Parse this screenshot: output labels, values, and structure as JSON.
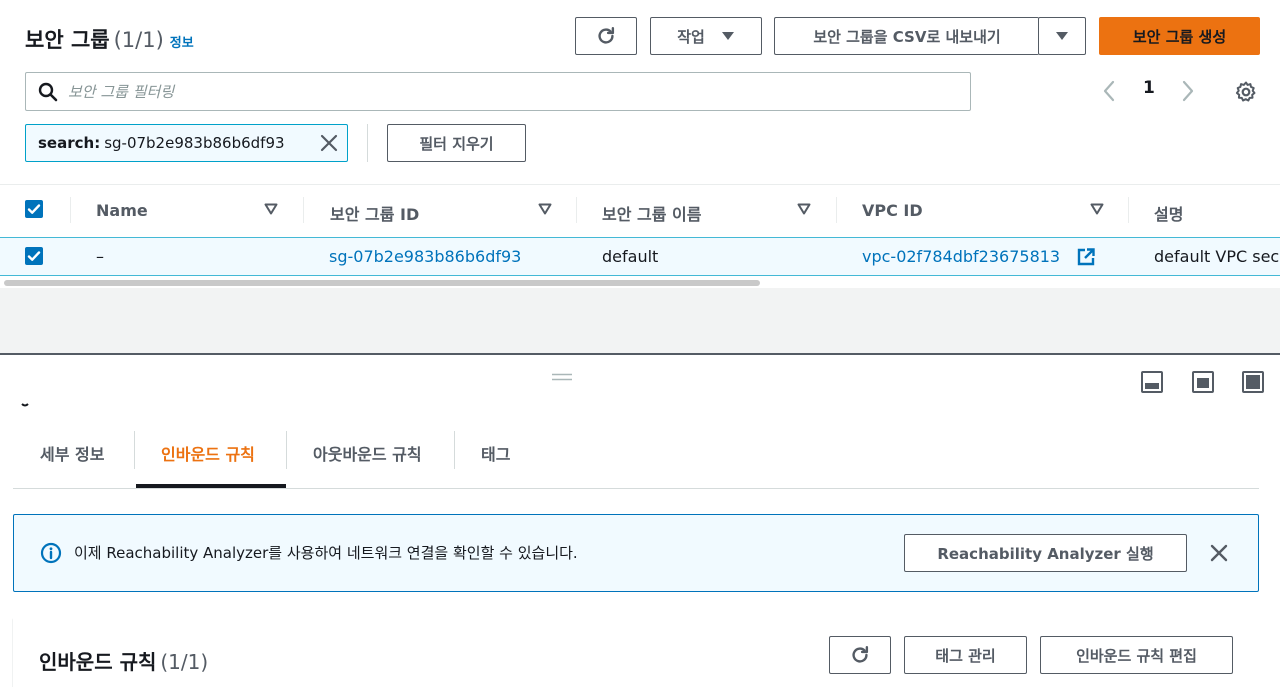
{
  "header": {
    "title": "보안 그룹",
    "count": "(1/1)",
    "info_link": "정보",
    "actions_label": "작업",
    "export_label": "보안 그룹을 CSV로 내보내기",
    "create_label": "보안 그룹 생성"
  },
  "search": {
    "placeholder": "보안 그룹 필터링",
    "token_key": "search:",
    "token_value": "sg-07b2e983b86b6df93",
    "clear_filters_label": "필터 지우기"
  },
  "pagination": {
    "current_page": "1"
  },
  "table": {
    "columns": [
      "Name",
      "보안 그룹 ID",
      "보안 그룹 이름",
      "VPC ID",
      "설명"
    ],
    "rows": [
      {
        "name": "–",
        "sg_id": "sg-07b2e983b86b6df93",
        "sg_name": "default",
        "vpc_id": "vpc-02f784dbf23675813",
        "description": "default VPC security group"
      }
    ]
  },
  "detail_tabs": [
    "세부 정보",
    "인바운드 규칙",
    "아웃바운드 규칙",
    "태그"
  ],
  "active_tab": "인바운드 규칙",
  "flash": {
    "message": "이제 Reachability Analyzer를 사용하여 네트워크 연결을 확인할 수 있습니다.",
    "action_label": "Reachability Analyzer 실행"
  },
  "inbound_panel": {
    "title": "인바운드 규칙",
    "count": "(1/1)",
    "manage_tags_label": "태그 관리",
    "edit_rules_label": "인바운드 규칙 편집"
  },
  "colors": {
    "primary": "#ec7211",
    "link": "#0073bb",
    "selected_row_bg": "#f1faff",
    "text": "#16191f",
    "secondary_text": "#545b64"
  },
  "icons": [
    "refresh-icon",
    "caret-down-icon",
    "search-icon",
    "chevron-left-icon",
    "chevron-right-icon",
    "gear-icon",
    "close-icon",
    "checkbox-checked-icon",
    "sort-caret-icon",
    "external-link-icon",
    "drag-handle-icon",
    "split-bottom-icon",
    "split-side-icon",
    "split-full-icon",
    "info-icon"
  ]
}
